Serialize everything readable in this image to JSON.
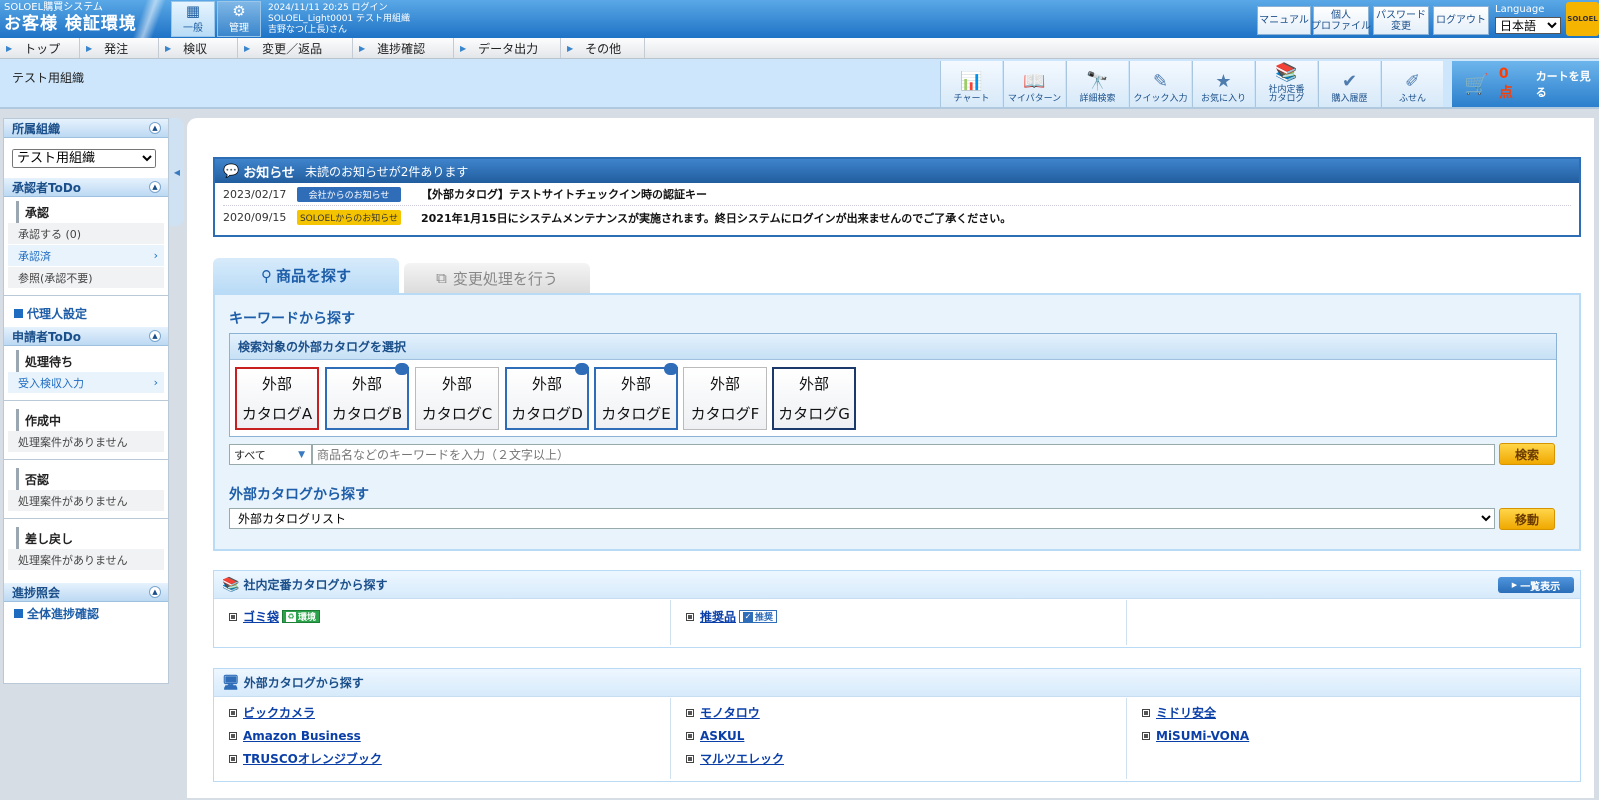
{
  "header": {
    "system_name": "SOLOEL購買システム",
    "env_name": "お客様 検証環境",
    "mode_general": "一般",
    "mode_admin": "管理",
    "login_time": "2024/11/11 20:25 ログイン",
    "user_line": "SOLOEL_Light0001 テスト用組織",
    "user_name": "吉野なつ(上長)さん",
    "buttons": {
      "manual": "マニュアル",
      "profile": "個人\nプロファイル",
      "password": "パスワード\n変更",
      "logout": "ログアウト"
    },
    "language_label": "Language",
    "language_value": "日本語",
    "logo": "SOLOEL"
  },
  "menu": [
    "トップ",
    "発注",
    "検収",
    "変更／返品",
    "進捗確認",
    "データ出力",
    "その他"
  ],
  "org_label": "テスト用組織",
  "toolbar": [
    {
      "label": "チャート",
      "icon": "chart-icon",
      "glyph": "📊"
    },
    {
      "label": "マイパターン",
      "icon": "book-icon",
      "glyph": "📖"
    },
    {
      "label": "詳細検索",
      "icon": "binoculars-icon",
      "glyph": "🔭"
    },
    {
      "label": "クイック入力",
      "icon": "quick-input-icon",
      "glyph": "✎"
    },
    {
      "label": "お気に入り",
      "icon": "star-icon",
      "glyph": "★"
    },
    {
      "label": "社内定番\nカタログ",
      "icon": "catalog-icon",
      "glyph": "📚"
    },
    {
      "label": "購入履歴",
      "icon": "history-icon",
      "glyph": "✔"
    },
    {
      "label": "ふせん",
      "icon": "sticky-note-icon",
      "glyph": "✐"
    }
  ],
  "cart": {
    "points": "0点",
    "label": "カートを見る"
  },
  "sidebar": {
    "org": {
      "title": "所属組織",
      "selected": "テスト用組織"
    },
    "approver": {
      "title": "承認者ToDo",
      "sub": "承認",
      "rows": [
        "承認する (0)",
        "承認済",
        "参照(承認不要)"
      ],
      "proxy": "代理人設定"
    },
    "applicant": {
      "title": "申請者ToDo",
      "pending": "処理待ち",
      "pending_row": "受入検収入力",
      "creating": "作成中",
      "creating_row": "処理案件がありません",
      "rejected": "否認",
      "rejected_row": "処理案件がありません",
      "returned": "差し戻し",
      "returned_row": "処理案件がありません"
    },
    "progress": {
      "title": "進捗照会",
      "link": "全体進捗確認"
    }
  },
  "notice": {
    "title": "お知らせ",
    "summary": "未読のお知らせが2件あります",
    "items": [
      {
        "date": "2023/02/17",
        "badge": "会社からのお知らせ",
        "text": "【外部カタログ】テストサイトチェックイン時の認証キー"
      },
      {
        "date": "2020/09/15",
        "badge": "SOLOELからのお知らせ",
        "text": "2021年1月15日にシステムメンテナンスが実施されます。終日システムにログインが出来ませんのでご了承ください。"
      }
    ]
  },
  "tabs": {
    "search": "商品を探す",
    "change": "変更処理を行う"
  },
  "search": {
    "keyword_title": "キーワードから探す",
    "catalog_box_title": "検索対象の外部カタログを選択",
    "catalogs": [
      {
        "line1": "外部",
        "line2": "カタログA"
      },
      {
        "line1": "外部",
        "line2": "カタログB"
      },
      {
        "line1": "外部",
        "line2": "カタログC"
      },
      {
        "line1": "外部",
        "line2": "カタログD"
      },
      {
        "line1": "外部",
        "line2": "カタログE"
      },
      {
        "line1": "外部",
        "line2": "カタログF"
      },
      {
        "line1": "外部",
        "line2": "カタログG"
      }
    ],
    "scope": "すべて",
    "placeholder": "商品名などのキーワードを入力（２文字以上）",
    "search_button": "検索",
    "catalog_title": "外部カタログから探す",
    "catalog_select": "外部カタログリスト",
    "move_button": "移動"
  },
  "internal": {
    "title": "社内定番カタログから探す",
    "list_button": "一覧表示",
    "items": [
      {
        "label": "ゴミ袋",
        "tag": "環境"
      },
      {
        "label": "推奨品",
        "tag": "推奨"
      }
    ]
  },
  "external": {
    "title": "外部カタログから探す",
    "col1": [
      "ビックカメラ",
      "Amazon Business",
      "TRUSCOオレンジブック"
    ],
    "col2": [
      "モノタロウ",
      "ASKUL",
      "マルツエレック"
    ],
    "col3": [
      "ミドリ安全",
      "MiSUMi-VONA"
    ]
  }
}
